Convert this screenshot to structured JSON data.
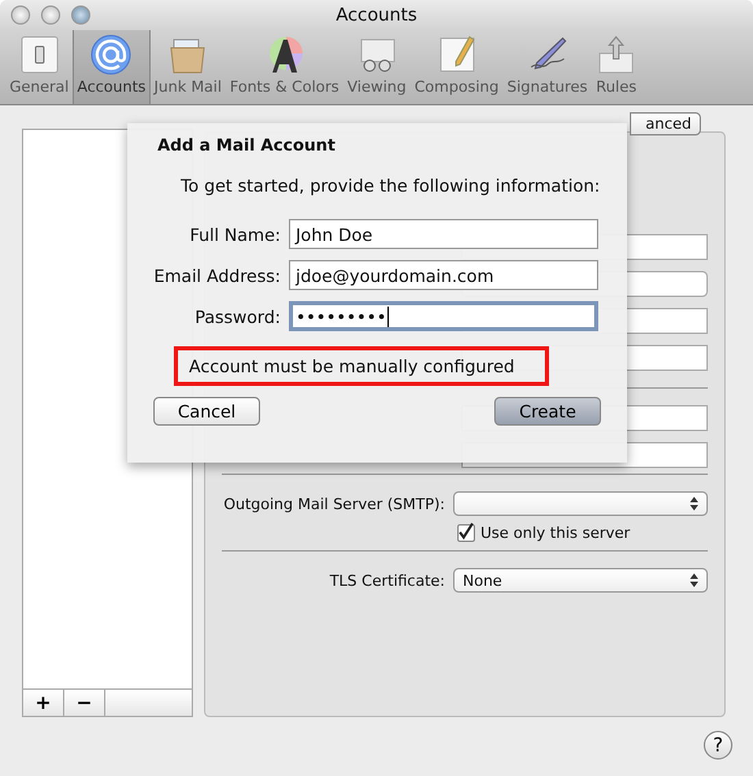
{
  "window": {
    "title": "Accounts"
  },
  "toolbar": {
    "items": [
      {
        "label": "General",
        "selected": false
      },
      {
        "label": "Accounts",
        "selected": true
      },
      {
        "label": "Junk Mail",
        "selected": false
      },
      {
        "label": "Fonts & Colors",
        "selected": false
      },
      {
        "label": "Viewing",
        "selected": false
      },
      {
        "label": "Composing",
        "selected": false
      },
      {
        "label": "Signatures",
        "selected": false
      },
      {
        "label": "Rules",
        "selected": false
      }
    ]
  },
  "account_list": {
    "add": "+",
    "remove": "−"
  },
  "panel": {
    "tab_visible": "anced",
    "smtp": {
      "label": "Outgoing Mail Server (SMTP):",
      "use_only": {
        "label": "Use only this server",
        "checked": true
      }
    },
    "tls": {
      "label": "TLS Certificate:",
      "value": "None"
    }
  },
  "sheet": {
    "title": "Add a Mail Account",
    "intro": "To get started, provide the following information:",
    "fields": [
      {
        "label": "Full Name:",
        "value": "John Doe",
        "focused": false
      },
      {
        "label": "Email Address:",
        "value": "jdoe@yourdomain.com",
        "focused": false
      },
      {
        "label": "Password:",
        "value": "•••••••••",
        "focused": true
      }
    ],
    "message": "Account must be manually configured",
    "buttons": [
      {
        "label": "Cancel",
        "kind": "normal"
      },
      {
        "label": "Create",
        "kind": "default"
      }
    ]
  },
  "help": "?"
}
